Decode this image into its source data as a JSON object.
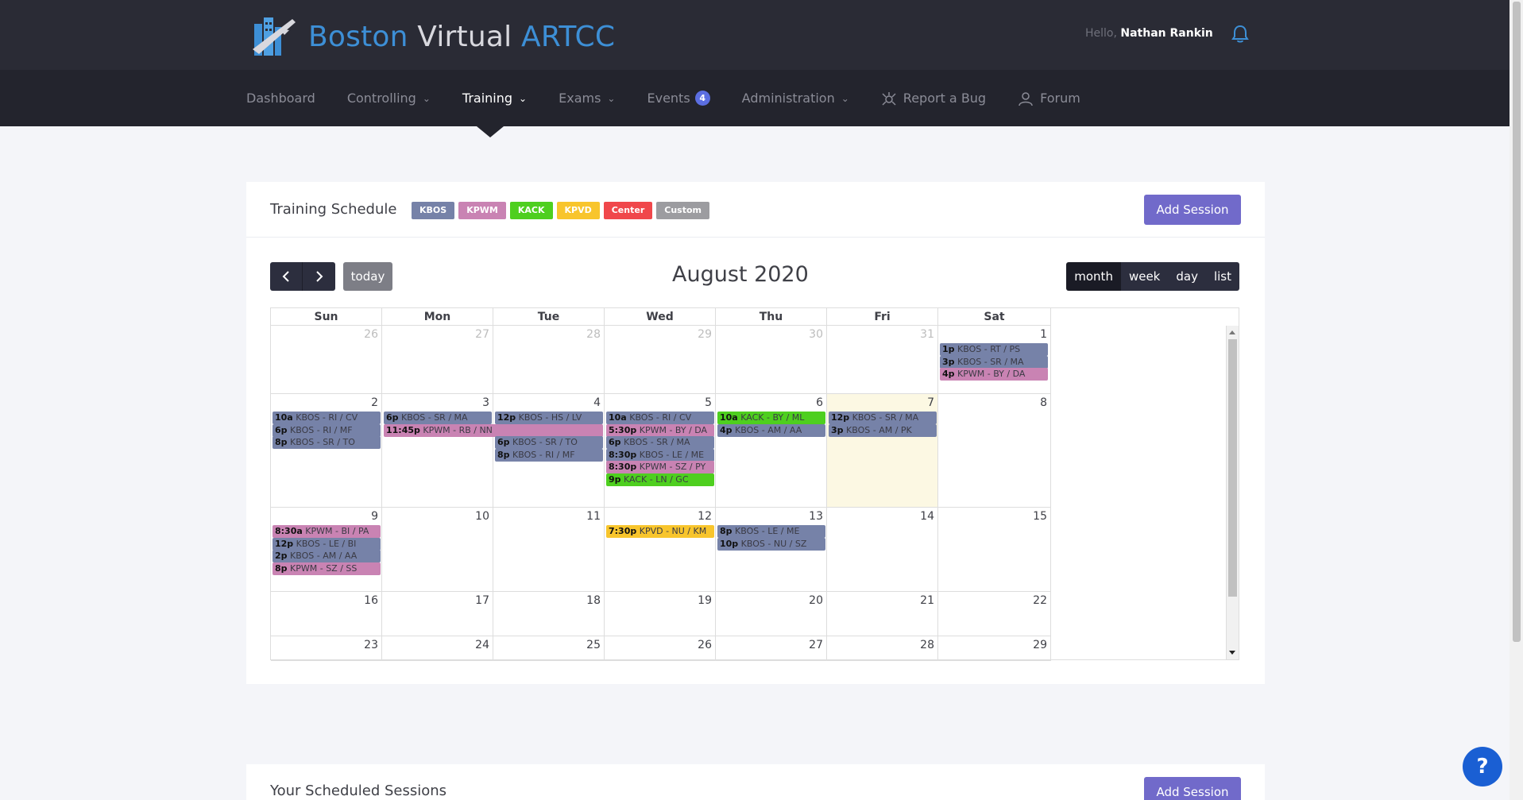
{
  "header": {
    "logo_part1": "Boston",
    "logo_part2": "Virtual",
    "logo_part3": "ARTCC",
    "hello_prefix": "Hello,",
    "user_name": "Nathan Rankin",
    "bell_icon": "bell-icon"
  },
  "nav": {
    "dashboard": "Dashboard",
    "controlling": "Controlling",
    "training": "Training",
    "exams": "Exams",
    "events": "Events",
    "events_count": "4",
    "administration": "Administration",
    "report_bug": "Report a Bug",
    "forum": "Forum"
  },
  "schedule": {
    "title": "Training Schedule",
    "add_session": "Add Session",
    "legend": [
      {
        "label": "KBOS",
        "color": "#7682a8"
      },
      {
        "label": "KPWM",
        "color": "#c983b3"
      },
      {
        "label": "KACK",
        "color": "#4ecf1f"
      },
      {
        "label": "KPVD",
        "color": "#f8c52c"
      },
      {
        "label": "Center",
        "color": "#f0474b"
      },
      {
        "label": "Custom",
        "color": "#9c9ca0"
      }
    ]
  },
  "calendar": {
    "title": "August 2020",
    "today_label": "today",
    "views": [
      "month",
      "week",
      "day",
      "list"
    ],
    "selected_view": "month",
    "dow": [
      "Sun",
      "Mon",
      "Tue",
      "Wed",
      "Thu",
      "Fri",
      "Sat"
    ],
    "today_date": 7,
    "weeks": [
      [
        {
          "d": "26",
          "o": true
        },
        {
          "d": "27",
          "o": true
        },
        {
          "d": "28",
          "o": true
        },
        {
          "d": "29",
          "o": true
        },
        {
          "d": "30",
          "o": true
        },
        {
          "d": "31",
          "o": true
        },
        {
          "d": "1"
        }
      ],
      [
        {
          "d": "2"
        },
        {
          "d": "3"
        },
        {
          "d": "4"
        },
        {
          "d": "5"
        },
        {
          "d": "6"
        },
        {
          "d": "7",
          "today": true
        },
        {
          "d": "8"
        }
      ],
      [
        {
          "d": "9"
        },
        {
          "d": "10"
        },
        {
          "d": "11"
        },
        {
          "d": "12"
        },
        {
          "d": "13"
        },
        {
          "d": "14"
        },
        {
          "d": "15"
        }
      ],
      [
        {
          "d": "16"
        },
        {
          "d": "17"
        },
        {
          "d": "18"
        },
        {
          "d": "19"
        },
        {
          "d": "20"
        },
        {
          "d": "21"
        },
        {
          "d": "22"
        }
      ],
      [
        {
          "d": "23"
        },
        {
          "d": "24"
        },
        {
          "d": "25"
        },
        {
          "d": "26"
        },
        {
          "d": "27"
        },
        {
          "d": "28"
        },
        {
          "d": "29"
        }
      ]
    ],
    "events": [
      {
        "w": 0,
        "c": 6,
        "slot": 0,
        "span": 1,
        "time": "1p",
        "text": "KBOS - RT / PS",
        "cat": "KBOS"
      },
      {
        "w": 0,
        "c": 6,
        "slot": 1,
        "span": 1,
        "time": "3p",
        "text": "KBOS - SR / MA",
        "cat": "KBOS"
      },
      {
        "w": 0,
        "c": 6,
        "slot": 2,
        "span": 1,
        "time": "4p",
        "text": "KPWM - BY / DA",
        "cat": "KPWM"
      },
      {
        "w": 1,
        "c": 0,
        "slot": 0,
        "span": 1,
        "time": "10a",
        "text": "KBOS - RI / CV",
        "cat": "KBOS"
      },
      {
        "w": 1,
        "c": 0,
        "slot": 1,
        "span": 1,
        "time": "6p",
        "text": "KBOS - RI / MF",
        "cat": "KBOS"
      },
      {
        "w": 1,
        "c": 0,
        "slot": 2,
        "span": 1,
        "time": "8p",
        "text": "KBOS - SR / TO",
        "cat": "KBOS"
      },
      {
        "w": 1,
        "c": 1,
        "slot": 0,
        "span": 1,
        "time": "6p",
        "text": "KBOS - SR / MA",
        "cat": "KBOS"
      },
      {
        "w": 1,
        "c": 1,
        "slot": 1,
        "span": 2,
        "time": "11:45p",
        "text": "KPWM - RB / NN",
        "cat": "KPWM"
      },
      {
        "w": 1,
        "c": 2,
        "slot": 0,
        "span": 1,
        "time": "12p",
        "text": "KBOS - HS / LV",
        "cat": "KBOS"
      },
      {
        "w": 1,
        "c": 2,
        "slot": 2,
        "span": 1,
        "time": "6p",
        "text": "KBOS - SR / TO",
        "cat": "KBOS"
      },
      {
        "w": 1,
        "c": 2,
        "slot": 3,
        "span": 1,
        "time": "8p",
        "text": "KBOS - RI / MF",
        "cat": "KBOS"
      },
      {
        "w": 1,
        "c": 3,
        "slot": 0,
        "span": 1,
        "time": "10a",
        "text": "KBOS - RI / CV",
        "cat": "KBOS"
      },
      {
        "w": 1,
        "c": 3,
        "slot": 1,
        "span": 1,
        "time": "5:30p",
        "text": "KPWM - BY / DA",
        "cat": "KPWM"
      },
      {
        "w": 1,
        "c": 3,
        "slot": 2,
        "span": 1,
        "time": "6p",
        "text": "KBOS - SR / MA",
        "cat": "KBOS"
      },
      {
        "w": 1,
        "c": 3,
        "slot": 3,
        "span": 1,
        "time": "8:30p",
        "text": "KBOS - LE / ME",
        "cat": "KBOS"
      },
      {
        "w": 1,
        "c": 3,
        "slot": 4,
        "span": 1,
        "time": "8:30p",
        "text": "KPWM - SZ / PY",
        "cat": "KPWM"
      },
      {
        "w": 1,
        "c": 3,
        "slot": 5,
        "span": 1,
        "time": "9p",
        "text": "KACK - LN / GC",
        "cat": "KACK"
      },
      {
        "w": 1,
        "c": 4,
        "slot": 0,
        "span": 1,
        "time": "10a",
        "text": "KACK - BY / ML",
        "cat": "KACK"
      },
      {
        "w": 1,
        "c": 4,
        "slot": 1,
        "span": 1,
        "time": "4p",
        "text": "KBOS - AM / AA",
        "cat": "KBOS"
      },
      {
        "w": 1,
        "c": 5,
        "slot": 0,
        "span": 1,
        "time": "12p",
        "text": "KBOS - SR / MA",
        "cat": "KBOS"
      },
      {
        "w": 1,
        "c": 5,
        "slot": 1,
        "span": 1,
        "time": "3p",
        "text": "KBOS - AM / PK",
        "cat": "KBOS"
      },
      {
        "w": 2,
        "c": 0,
        "slot": 0,
        "span": 1,
        "time": "8:30a",
        "text": "KPWM - BI / PA",
        "cat": "KPWM"
      },
      {
        "w": 2,
        "c": 0,
        "slot": 1,
        "span": 1,
        "time": "12p",
        "text": "KBOS - LE / BI",
        "cat": "KBOS"
      },
      {
        "w": 2,
        "c": 0,
        "slot": 2,
        "span": 1,
        "time": "2p",
        "text": "KBOS - AM / AA",
        "cat": "KBOS"
      },
      {
        "w": 2,
        "c": 0,
        "slot": 3,
        "span": 1,
        "time": "8p",
        "text": "KPWM - SZ / SS",
        "cat": "KPWM"
      },
      {
        "w": 2,
        "c": 3,
        "slot": 0,
        "span": 1,
        "time": "7:30p",
        "text": "KPVD - NU / KM",
        "cat": "KPVD"
      },
      {
        "w": 2,
        "c": 4,
        "slot": 0,
        "span": 1,
        "time": "8p",
        "text": "KBOS - LE / ME",
        "cat": "KBOS"
      },
      {
        "w": 2,
        "c": 4,
        "slot": 1,
        "span": 1,
        "time": "10p",
        "text": "KBOS - NU / SZ",
        "cat": "KBOS"
      }
    ]
  },
  "sessions": {
    "title": "Your Scheduled Sessions",
    "add_session": "Add Session"
  },
  "help": {
    "label": "?"
  }
}
